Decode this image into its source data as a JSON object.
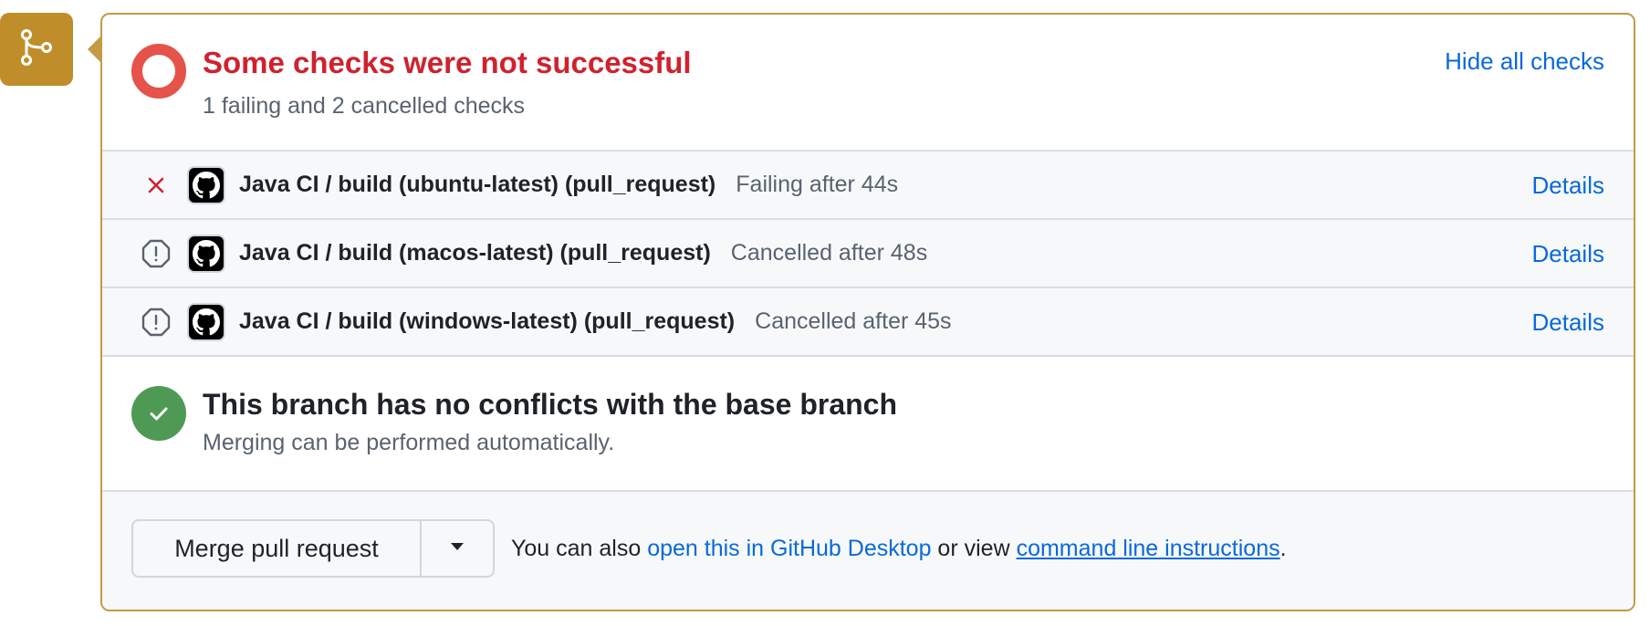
{
  "colors": {
    "badge": "#bf8e2a",
    "failure": "#cf222e",
    "success": "#4e9a55",
    "link": "#0969da"
  },
  "badge_icon": "git-merge-icon",
  "checks": {
    "title": "Some checks were not successful",
    "subtitle": "1 failing and 2 cancelled checks",
    "hide_all_label": "Hide all checks",
    "rows": [
      {
        "status_icon": "x-icon",
        "name": "Java CI / build (ubuntu-latest) (pull_request)",
        "status": "Failing after 44s",
        "details_label": "Details"
      },
      {
        "status_icon": "stop-icon",
        "name": "Java CI / build (macos-latest) (pull_request)",
        "status": "Cancelled after 48s",
        "details_label": "Details"
      },
      {
        "status_icon": "stop-icon",
        "name": "Java CI / build (windows-latest) (pull_request)",
        "status": "Cancelled after 45s",
        "details_label": "Details"
      }
    ]
  },
  "merge_status": {
    "title": "This branch has no conflicts with the base branch",
    "subtitle": "Merging can be performed automatically."
  },
  "merge_footer": {
    "merge_button_label": "Merge pull request",
    "text_prefix": "You can also ",
    "desktop_link": "open this in GitHub Desktop",
    "text_middle": " or view ",
    "cli_link": "command line instructions",
    "text_suffix": "."
  }
}
